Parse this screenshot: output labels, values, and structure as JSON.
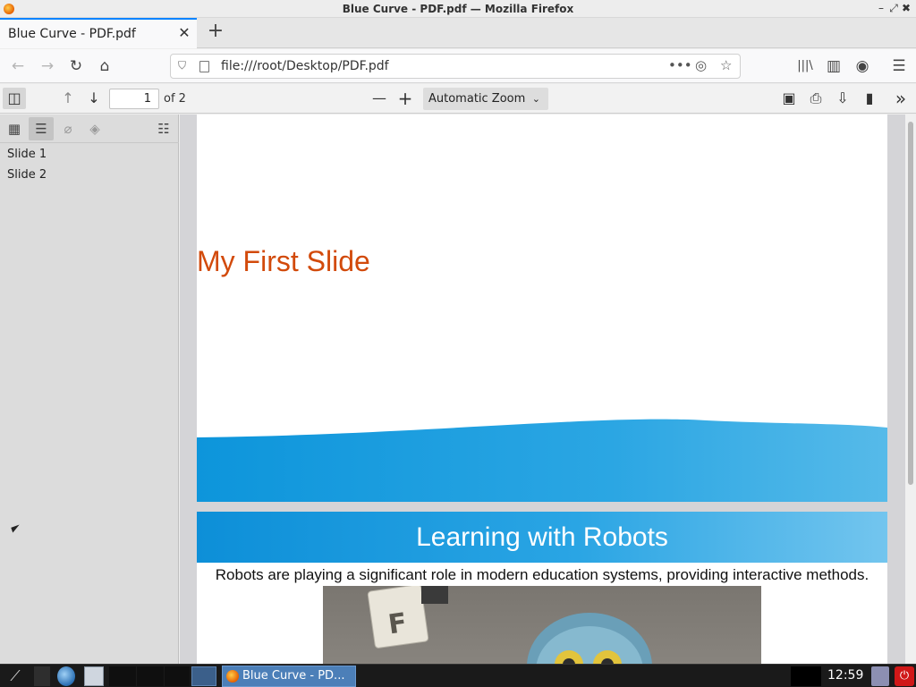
{
  "window": {
    "title": "Blue Curve - PDF.pdf — Mozilla Firefox",
    "controls": {
      "minimize": "–",
      "maximize": "⤢",
      "close": "✖"
    }
  },
  "tabs": [
    {
      "label": "Blue Curve - PDF.pdf",
      "close": "✕"
    }
  ],
  "new_tab": "+",
  "navbar": {
    "back": "←",
    "forward": "→",
    "reload": "↻",
    "home": "⌂",
    "url": "file:///root/Desktop/PDF.pdf",
    "page_actions": "•••",
    "pocket": "◎",
    "bookmark_star": "☆",
    "library": "|||\\",
    "sidebar_toggle": "▥",
    "account": "◉",
    "menu": "☰"
  },
  "pdf_toolbar": {
    "toggle_sidebar": "◫",
    "prev_page": "↑",
    "next_page": "↓",
    "page_number": "1",
    "page_count": "of 2",
    "zoom_out": "—",
    "zoom_in": "+",
    "zoom_value": "Automatic Zoom",
    "zoom_caret": "⌄",
    "presentation": "▣",
    "print": "⎙",
    "download": "⇩",
    "bookmark": "▮",
    "more_tools": "»"
  },
  "sidebar": {
    "tools": {
      "thumbnails": "▦",
      "outline": "☰",
      "attachments": "⌀",
      "layers": "◈",
      "current_outline": "☷"
    },
    "outline": [
      "Slide 1",
      "Slide 2"
    ]
  },
  "document": {
    "slide1_title": "My First Slide",
    "slide2_title": "Learning with Robots",
    "slide2_body": "Robots are playing a significant role in modern education systems, providing interactive methods."
  },
  "taskbar": {
    "app_label": "Blue Curve - PD...",
    "clock": "12:59"
  },
  "colors": {
    "accent_blue": "#0a84ff",
    "slide_title": "#d24a0b",
    "slide_curve": "#1a9ee0"
  }
}
